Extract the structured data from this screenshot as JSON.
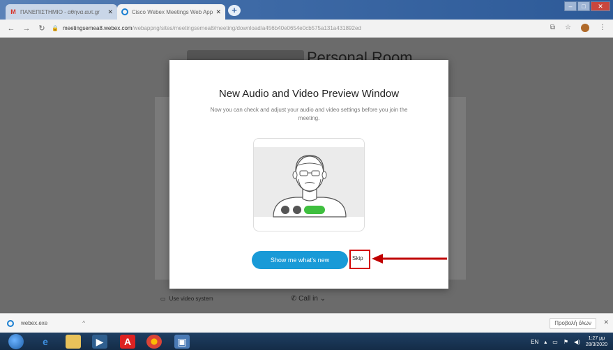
{
  "browser": {
    "tabs": [
      {
        "title": "ΠΑΝΕΠΙΣΤΗΜΙΟ - αθηνα.αυτ.gr",
        "active": false
      },
      {
        "title": "Cisco Webex Meetings Web App",
        "active": true
      }
    ],
    "address": {
      "host": "meetingsemea8.webex.com",
      "path": "/webappng/sites/meetingsemea8/meeting/download/a456b40e0654e0cb575a131a431892ed"
    },
    "toolbar_icons": [
      "back-icon",
      "forward-icon",
      "reload-icon",
      "lock-icon",
      "translate-icon",
      "star-icon",
      "profile-icon",
      "menu-icon"
    ]
  },
  "page": {
    "background_title": "Personal Room",
    "bottom_left_label": "Use video system",
    "bottom_right_label": "Call in"
  },
  "modal": {
    "title": "New Audio and Video Preview Window",
    "description": "Now you can check and adjust your audio and video settings before you join the meeting.",
    "primary_button": "Show me what's new",
    "skip_link": "Skip"
  },
  "download_bar": {
    "file": "webex.exe",
    "show_all": "Προβολή όλων"
  },
  "taskbar": {
    "time": "1:27 μμ",
    "date": "28/3/2020",
    "language": "EN"
  },
  "colors": {
    "primary_button": "#199ad7",
    "highlight_box": "#d40000",
    "overlay": "#6b6b6b",
    "toggle_green": "#3fbf3f"
  }
}
